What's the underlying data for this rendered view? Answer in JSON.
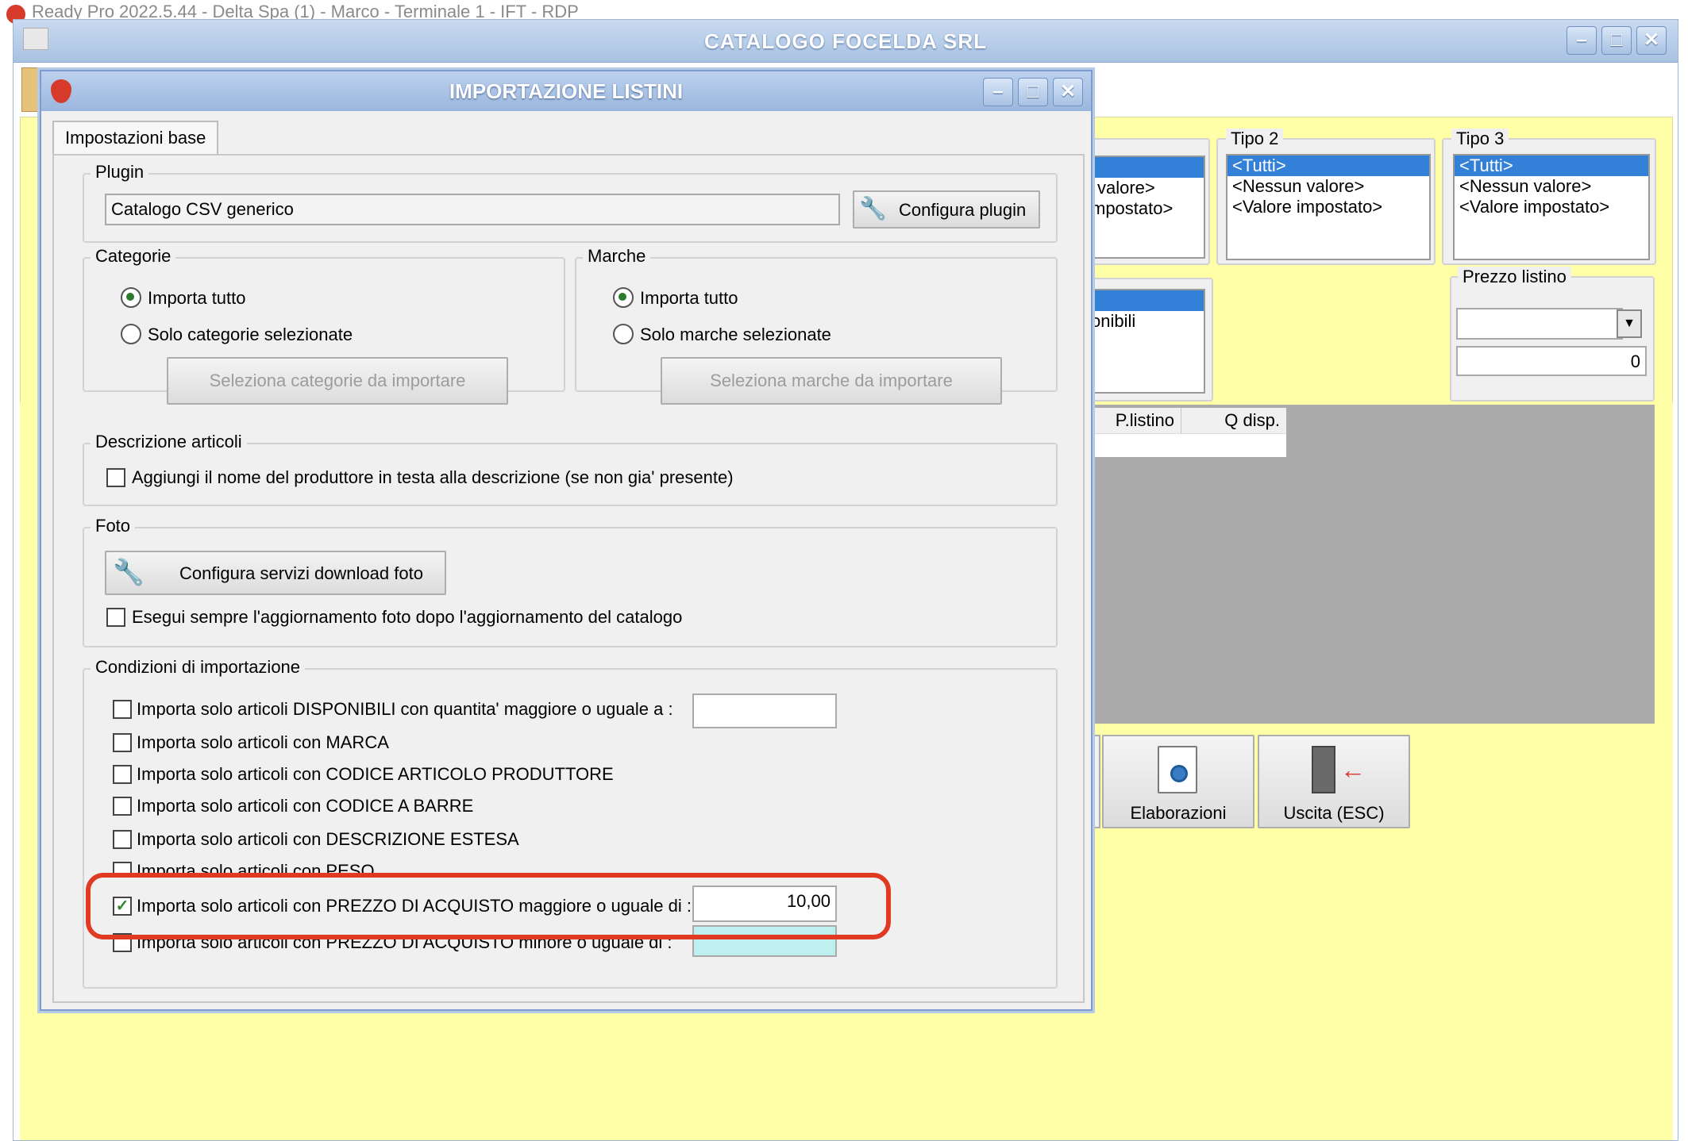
{
  "app": {
    "title": "Ready Pro 2022.5.44 - Delta Spa (1) - Marco - Terminale 1 - IFT - RDP"
  },
  "outer_window": {
    "title": "CATALOGO FOCELDA SRL",
    "tipo2": {
      "label": "Tipo 2",
      "items": [
        "<Tutti>",
        "<Nessun valore>",
        "<Valore impostato>"
      ]
    },
    "tipo3": {
      "label": "Tipo 3",
      "items": [
        "<Tutti>",
        "<Nessun valore>",
        "<Valore impostato>"
      ]
    },
    "partial_list1": [
      "valore>",
      "mpostato>"
    ],
    "partial_list2": [
      "onibili"
    ],
    "prezzo_listino": {
      "label": "Prezzo listino",
      "select_value": "",
      "value": "0"
    },
    "grid_columns": [
      "P.listino",
      "Q disp."
    ],
    "buttons": {
      "elaborazioni": "Elaborazioni",
      "uscita": "Uscita (ESC)"
    }
  },
  "dialog": {
    "title": "IMPORTAZIONE LISTINI",
    "tab": "Impostazioni base",
    "plugin": {
      "label": "Plugin",
      "value": "Catalogo CSV generico",
      "configure_button": "Configura plugin"
    },
    "categorie": {
      "label": "Categorie",
      "option_all": "Importa tutto",
      "option_selected": "Solo categorie selezionate",
      "button": "Seleziona categorie da importare",
      "selected_option": "all"
    },
    "marche": {
      "label": "Marche",
      "option_all": "Importa tutto",
      "option_selected": "Solo marche selezionate",
      "button": "Seleziona marche da importare",
      "selected_option": "all"
    },
    "descrizione": {
      "label": "Descrizione articoli",
      "checkbox": "Aggiungi il nome del produttore in testa alla descrizione (se non gia' presente)",
      "checked": false
    },
    "foto": {
      "label": "Foto",
      "button": "Configura servizi download foto",
      "checkbox": "Esegui sempre l'aggiornamento foto dopo l'aggiornamento del catalogo",
      "checked": false
    },
    "condizioni": {
      "label": "Condizioni di importazione",
      "items": [
        {
          "label": "Importa solo articoli DISPONIBILI con quantita' maggiore o uguale a :",
          "checked": false,
          "input": ""
        },
        {
          "label": "Importa solo articoli con MARCA",
          "checked": false
        },
        {
          "label": "Importa solo articoli con CODICE ARTICOLO PRODUTTORE",
          "checked": false
        },
        {
          "label": "Importa solo articoli con CODICE A BARRE",
          "checked": false
        },
        {
          "label": "Importa solo articoli con DESCRIZIONE ESTESA",
          "checked": false
        },
        {
          "label": "Importa solo articoli con PESO",
          "checked": false
        },
        {
          "label": "Importa solo articoli con PREZZO DI ACQUISTO maggiore o uguale di :",
          "checked": true,
          "input": "10,00"
        },
        {
          "label": "Importa solo articoli con PREZZO DI ACQUISTO minore o uguale di :",
          "checked": false,
          "input": ""
        }
      ]
    }
  },
  "colors": {
    "highlight": "#e03a23",
    "selection": "#3380d8",
    "background_yellow": "#ffffa8"
  }
}
